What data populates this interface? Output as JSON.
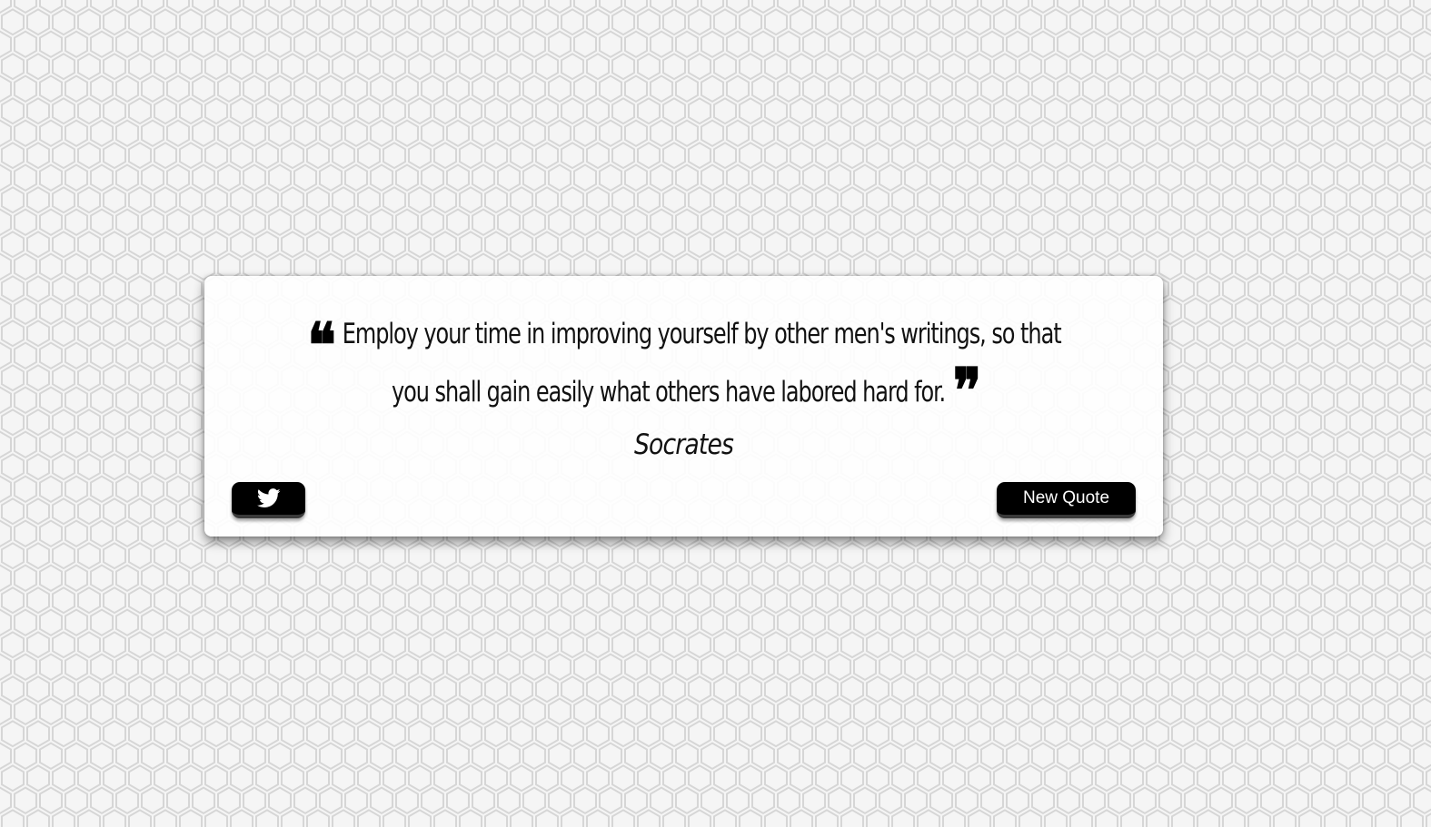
{
  "quote": {
    "text": "Employ your time in improving yourself by other men's writings, so that you shall gain easily what others have labored hard for.",
    "open_mark": "❝",
    "close_mark": "❞",
    "author": "Socrates"
  },
  "actions": {
    "twitter_icon": "twitter-icon",
    "new_quote_label": "New Quote"
  },
  "colors": {
    "card_background": "#ffffff",
    "button_background": "#000000",
    "button_text": "#ffffff",
    "page_background": "#f5f5f5"
  }
}
